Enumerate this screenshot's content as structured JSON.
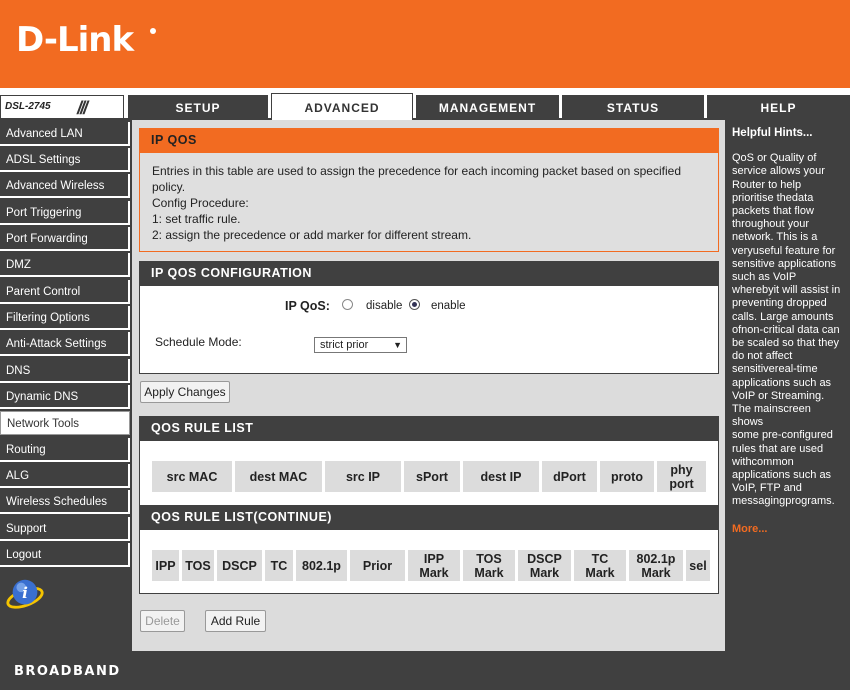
{
  "brand": {
    "logo": "D-Link",
    "model": "DSL-2745",
    "footer": "BROADBAND"
  },
  "nav": {
    "tabs": [
      {
        "label": "SETUP"
      },
      {
        "label": "ADVANCED"
      },
      {
        "label": "MANAGEMENT"
      },
      {
        "label": "STATUS"
      },
      {
        "label": "HELP"
      }
    ],
    "active_tab": "ADVANCED"
  },
  "sidebar": {
    "items": [
      {
        "label": "Advanced LAN"
      },
      {
        "label": "ADSL Settings"
      },
      {
        "label": "Advanced Wireless"
      },
      {
        "label": "Port Triggering"
      },
      {
        "label": "Port Forwarding"
      },
      {
        "label": "DMZ"
      },
      {
        "label": "Parent Control"
      },
      {
        "label": "Filtering Options"
      },
      {
        "label": "Anti-Attack Settings"
      },
      {
        "label": "DNS"
      },
      {
        "label": "Dynamic DNS"
      },
      {
        "label": "Network Tools"
      },
      {
        "label": "Routing"
      },
      {
        "label": "ALG"
      },
      {
        "label": "Wireless Schedules"
      },
      {
        "label": "Support"
      },
      {
        "label": "Logout"
      }
    ],
    "active_item": "Network Tools"
  },
  "intro": {
    "title": "IP QOS",
    "line1": "Entries in this table are used to assign the precedence for each incoming packet based on specified",
    "line2": "policy.",
    "line3": "Config Procedure:",
    "line4": "1: set traffic rule.",
    "line5": "2: assign the precedence or add marker for different stream."
  },
  "config": {
    "title": "IP QOS CONFIGURATION",
    "qos_label": "IP QoS:",
    "disable_label": "disable",
    "enable_label": "enable",
    "selected": "enable",
    "schedule_label": "Schedule Mode:",
    "schedule_value": "strict prior"
  },
  "apply_button": "Apply Changes",
  "rule_list": {
    "title": "QOS RULE LIST",
    "columns": [
      "src MAC",
      "dest MAC",
      "src IP",
      "sPort",
      "dest IP",
      "dPort",
      "proto",
      "phy port"
    ]
  },
  "rule_list_continue": {
    "title": "QOS RULE LIST(CONTINUE)",
    "columns": [
      "IPP",
      "TOS",
      "DSCP",
      "TC",
      "802.1p",
      "Prior",
      "IPP Mark",
      "TOS Mark",
      "DSCP Mark",
      "TC Mark",
      "802.1p Mark",
      "sel"
    ]
  },
  "buttons": {
    "delete": "Delete",
    "add_rule": "Add Rule"
  },
  "hints": {
    "title": "Helpful Hints...",
    "lines": [
      "QoS or Quality of",
      "service allows your",
      "Router to help",
      "prioritise thedata",
      "packets that flow",
      "throughout your",
      "network. This is a",
      "veryuseful feature for",
      "sensitive applications",
      "such as VoIP",
      "wherebyit will assist in",
      "preventing dropped",
      "calls. Large amounts",
      "ofnon-critical data can",
      "be scaled so that they",
      "do not affect",
      "sensitivereal-time",
      "applications such as",
      "VoIP or Streaming.",
      "The mainscreen shows",
      "some pre-configured",
      "rules that are used",
      "withcommon",
      "applications such as",
      "VoIP, FTP and",
      "messagingprograms."
    ],
    "more": "More..."
  },
  "colors": {
    "accent": "#f26b21",
    "dark": "#404040",
    "panel": "#dcdcdc"
  }
}
